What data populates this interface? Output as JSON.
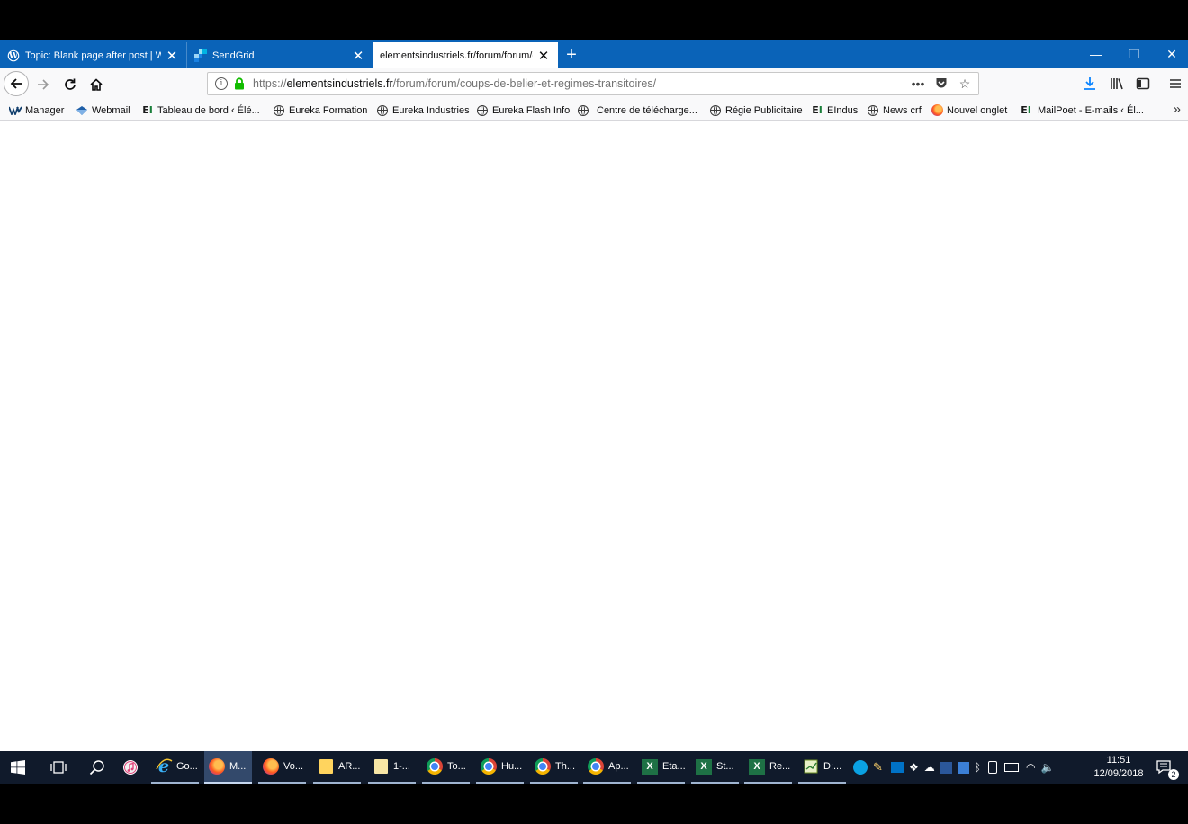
{
  "tabs": [
    {
      "title": "Topic: Blank page after post | WordPress.org",
      "favicon": "wordpress-icon"
    },
    {
      "title": "SendGrid",
      "favicon": "sendgrid-icon"
    },
    {
      "title": "elementsindustriels.fr/forum/forum/coups-de-belier-et-regimes-transitoires/",
      "favicon": "none",
      "active": true
    }
  ],
  "nav": {
    "url_prefix": "https://",
    "url_host": "elementsindustriels.fr",
    "url_path": "/forum/forum/coups-de-belier-et-regimes-transitoires/"
  },
  "bookmarks": [
    {
      "label": "Manager",
      "icon": "ovh-icon"
    },
    {
      "label": "Webmail",
      "icon": "webmail-icon"
    },
    {
      "label": "Tableau de bord ‹ Élé...",
      "icon": "ei-icon"
    },
    {
      "label": "Eureka Formation",
      "icon": "globe-icon"
    },
    {
      "label": "Eureka Industries",
      "icon": "globe-icon"
    },
    {
      "label": "Eureka Flash Info",
      "icon": "globe-icon"
    },
    {
      "label": "Centre de télécharge...",
      "icon": "globe-icon"
    },
    {
      "label": "Régie Publicitaire",
      "icon": "globe-icon"
    },
    {
      "label": "EIndus",
      "icon": "ei-icon"
    },
    {
      "label": "News crf",
      "icon": "globe-icon"
    },
    {
      "label": "Nouvel onglet",
      "icon": "firefox-icon"
    },
    {
      "label": "MailPoet - E-mails ‹ Él...",
      "icon": "ei-icon"
    }
  ],
  "taskbar": {
    "apps": [
      {
        "label": "Go...",
        "icon": "ie-icon"
      },
      {
        "label": "M...",
        "icon": "firefox-icon"
      },
      {
        "label": "Vo...",
        "icon": "firefox-icon"
      },
      {
        "label": "AR...",
        "icon": "folder-icon"
      },
      {
        "label": "1-...",
        "icon": "folder-icon"
      },
      {
        "label": "To...",
        "icon": "chrome-icon"
      },
      {
        "label": "Hu...",
        "icon": "chrome-icon"
      },
      {
        "label": "Th...",
        "icon": "chrome-icon"
      },
      {
        "label": "Ap...",
        "icon": "chrome-icon"
      },
      {
        "label": "Eta...",
        "icon": "excel-icon"
      },
      {
        "label": "St...",
        "icon": "excel-icon"
      },
      {
        "label": "Re...",
        "icon": "excel-icon"
      },
      {
        "label": "D:...",
        "icon": "notepad-icon"
      }
    ],
    "time": "11:51",
    "date": "12/09/2018",
    "notification_count": "2"
  },
  "colors": {
    "tabstrip": "#0a63b8",
    "taskbar": "#101a2b"
  }
}
